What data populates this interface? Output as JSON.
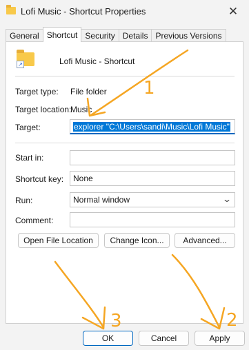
{
  "window": {
    "title": "Lofi Music - Shortcut Properties",
    "close_glyph": "✕"
  },
  "tabs": [
    {
      "label": "General"
    },
    {
      "label": "Shortcut"
    },
    {
      "label": "Security"
    },
    {
      "label": "Details"
    },
    {
      "label": "Previous Versions"
    }
  ],
  "shortcut": {
    "name": "Lofi Music - Shortcut",
    "target_type_label": "Target type:",
    "target_type_value": "File folder",
    "target_location_label": "Target location:",
    "target_location_value": "Music",
    "target_label": "Target:",
    "target_value": "explorer \"C:\\Users\\sandi\\Music\\Lofi Music\"",
    "start_in_label": "Start in:",
    "start_in_value": "",
    "shortcut_key_label": "Shortcut key:",
    "shortcut_key_value": "None",
    "run_label": "Run:",
    "run_value": "Normal window",
    "comment_label": "Comment:",
    "comment_value": ""
  },
  "buttons": {
    "open_location": "Open File Location",
    "change_icon": "Change Icon...",
    "advanced": "Advanced...",
    "ok": "OK",
    "cancel": "Cancel",
    "apply": "Apply"
  },
  "annotations": {
    "mark_1": "1",
    "mark_2": "2",
    "mark_3": "3"
  },
  "colors": {
    "annotation": "#f5a623",
    "accent": "#0067c0",
    "selection": "#0078d7"
  }
}
